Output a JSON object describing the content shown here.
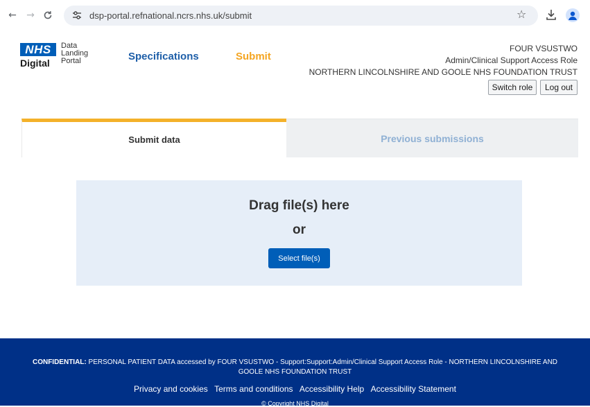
{
  "browser": {
    "url": "dsp-portal.refnational.ncrs.nhs.uk/submit",
    "back_icon": "←",
    "forward_icon": "→",
    "reload_icon": "C",
    "tune_icon": "⚙",
    "star_icon": "☆"
  },
  "logo": {
    "nhs": "NHS",
    "digital": "Digital",
    "portal_line1": "Data",
    "portal_line2": "Landing",
    "portal_line3": "Portal"
  },
  "nav": {
    "specifications": "Specifications",
    "submit": "Submit"
  },
  "user": {
    "name": "FOUR VSUSTWO",
    "role": "Admin/Clinical Support Access Role",
    "organisation": "NORTHERN LINCOLNSHIRE AND GOOLE NHS FOUNDATION TRUST",
    "switch_role": "Switch role",
    "log_out": "Log out"
  },
  "tabs": {
    "submit_data": "Submit data",
    "previous_submissions": "Previous submissions"
  },
  "dropzone": {
    "heading": "Drag file(s) here",
    "or": "or",
    "select_button": "Select file(s)"
  },
  "footer": {
    "confidential_label": "CONFIDENTIAL:",
    "confidential_text": "PERSONAL PATIENT DATA accessed by FOUR VSUSTWO - Support:Support:Admin/Clinical Support Access Role - NORTHERN LINCOLNSHIRE AND GOOLE NHS FOUNDATION TRUST",
    "links": [
      "Privacy and cookies",
      "Terms and conditions",
      "Accessibility Help",
      "Accessibility Statement"
    ],
    "copyright": "© Copyright NHS Digital"
  },
  "colors": {
    "nhs_blue": "#005eb8",
    "footer_navy": "#003087",
    "accent_yellow": "#f4b12a",
    "dropzone_bg": "#e6eef8"
  }
}
